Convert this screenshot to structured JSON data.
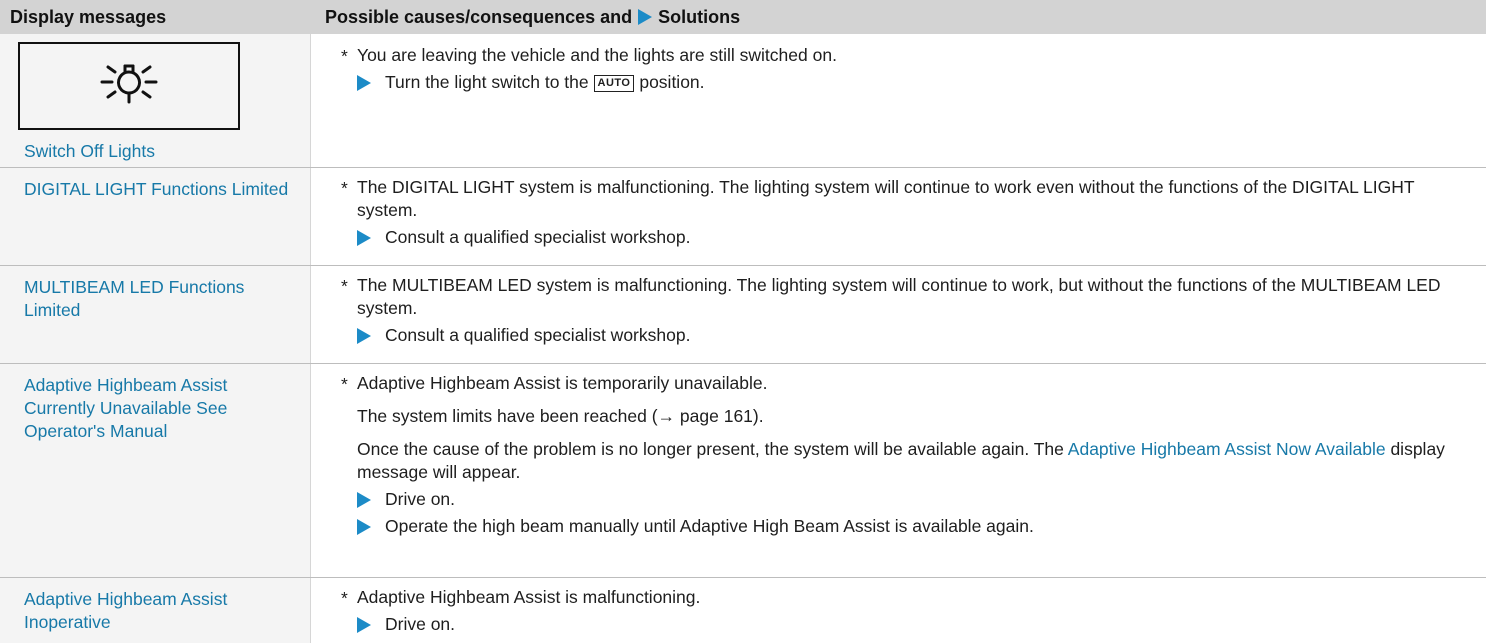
{
  "header": {
    "col1": "Display messages",
    "col2_prefix": "Possible causes/consequences and",
    "col2_suffix": "Solutions"
  },
  "rows": [
    {
      "icon": "light-on-icon",
      "message": "Switch Off Lights",
      "cause": "You are leaving the vehicle and the lights are still switched on.",
      "solution_before": "Turn the light switch to the",
      "key": "AUTO",
      "solution_after": "position."
    },
    {
      "message": "DIGITAL LIGHT Functions Limited",
      "cause": "The DIGITAL LIGHT system is malfunctioning. The lighting system will continue to work even without the functions of the DIGITAL LIGHT system.",
      "solution": "Consult a qualified specialist workshop."
    },
    {
      "message": "MULTIBEAM LED Functions Limited",
      "cause": "The MULTIBEAM LED system is malfunctioning. The lighting system will continue to work, but without the functions of the MULTIBEAM LED system.",
      "solution": "Consult a qualified specialist workshop."
    },
    {
      "message": "Adaptive Highbeam Assist Currently Unavailable See Operator's Manual",
      "cause": "Adaptive Highbeam Assist is temporarily unavailable.",
      "para1": "The system limits have been reached (→ page 161).",
      "para2_before": "Once the cause of the problem is no longer present, the system will be available again. The",
      "para2_link": "Adaptive Highbeam Assist Now Available",
      "para2_after": "display message will appear.",
      "solution1": "Drive on.",
      "solution2": "Operate the high beam manually until Adaptive High Beam Assist is available again."
    },
    {
      "message": "Adaptive Highbeam Assist Inoperative",
      "cause": "Adaptive Highbeam Assist is malfunctioning.",
      "solution": "Drive on."
    }
  ],
  "colors": {
    "link": "#1779a8",
    "arrow": "#1c8bc7",
    "header_bg": "#d3d3d3",
    "cell_bg": "#f4f4f4"
  }
}
